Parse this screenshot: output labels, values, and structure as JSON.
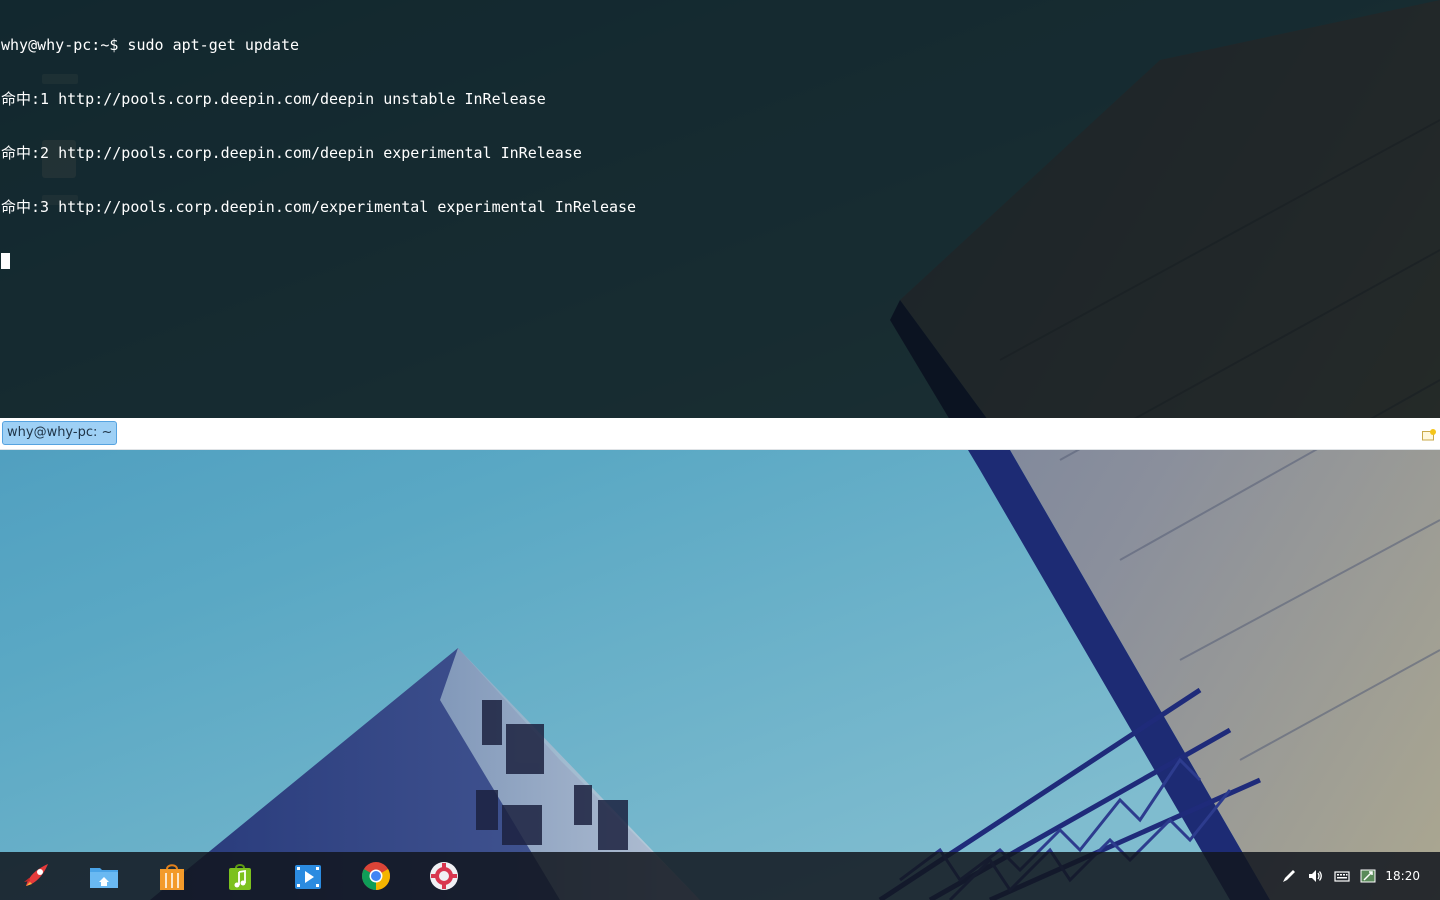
{
  "terminal": {
    "lines": [
      "why@why-pc:~$ sudo apt-get update",
      "命中:1 http://pools.corp.deepin.com/deepin unstable InRelease",
      "命中:2 http://pools.corp.deepin.com/deepin experimental InRelease",
      "命中:3 http://pools.corp.deepin.com/experimental experimental InRelease"
    ],
    "background": "#080e0c",
    "foreground": "#ffffff"
  },
  "tabbar": {
    "active_tab_label": "why@why-pc: ~",
    "new_tab_icon": "new-tab-icon",
    "accent": "#9ed0f5"
  },
  "dock": {
    "apps": [
      {
        "name": "launcher",
        "icon": "rocket-icon"
      },
      {
        "name": "file-manager",
        "icon": "folder-home-icon"
      },
      {
        "name": "app-store",
        "icon": "shopping-bag-icon"
      },
      {
        "name": "music-player",
        "icon": "music-bag-icon"
      },
      {
        "name": "movie-player",
        "icon": "film-play-icon"
      },
      {
        "name": "chrome",
        "icon": "chrome-icon"
      },
      {
        "name": "control-center",
        "icon": "gear-icon"
      }
    ],
    "tray": [
      {
        "name": "screenshot",
        "icon": "pen-icon"
      },
      {
        "name": "volume",
        "icon": "speaker-icon"
      },
      {
        "name": "keyboard",
        "icon": "keyboard-icon"
      },
      {
        "name": "network",
        "icon": "network-icon"
      }
    ],
    "clock": "18:20"
  }
}
